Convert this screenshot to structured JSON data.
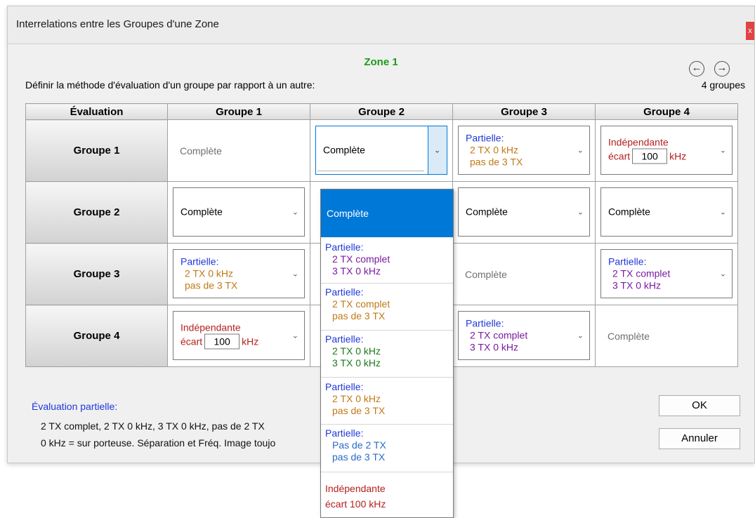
{
  "window": {
    "title": "Interrelations entre les Groupes d'une Zone",
    "close_label": "x"
  },
  "zone_title": "Zone 1",
  "nav": {
    "prev_icon": "arrow-left-circle-icon",
    "next_icon": "arrow-right-circle-icon",
    "prev_glyph": "←",
    "next_glyph": "→"
  },
  "instruction": "Définir la méthode d'évaluation d'un groupe par rapport à un autre:",
  "group_count": "4 groupes",
  "table": {
    "header": [
      "Évaluation",
      "Groupe 1",
      "Groupe 2",
      "Groupe 3",
      "Groupe 4"
    ],
    "rows": [
      {
        "label": "Groupe 1",
        "c1": "Complète",
        "c2": "Complète",
        "c3": {
          "l1": "Partielle:",
          "l2": "2 TX 0 kHz",
          "l3": "pas de 3 TX"
        },
        "c4": {
          "l1": "Indépendante",
          "l2a": "écart",
          "val": "100",
          "l2b": "kHz"
        }
      },
      {
        "label": "Groupe 2",
        "c1": "Complète",
        "c3": "Complète",
        "c4": "Complète"
      },
      {
        "label": "Groupe 3",
        "c1": {
          "l1": "Partielle:",
          "l2": "2 TX 0 kHz",
          "l3": "pas de 3 TX"
        },
        "c3": "Complète",
        "c4": {
          "l1": "Partielle:",
          "l2": "2 TX complet",
          "l3": "3 TX 0 kHz"
        }
      },
      {
        "label": "Groupe 4",
        "c1": {
          "l1": "Indépendante",
          "l2a": "écart",
          "val": "100",
          "l2b": "kHz"
        },
        "c3": {
          "l1": "Partielle:",
          "l2": "2 TX complet",
          "l3": "3 TX 0 kHz"
        },
        "c4": "Complète"
      }
    ]
  },
  "dropdown": {
    "items": [
      {
        "l1": "Complète"
      },
      {
        "l1": "Partielle:",
        "l2": "2 TX complet",
        "l3": "3 TX 0 kHz"
      },
      {
        "l1": "Partielle:",
        "l2": "2 TX complet",
        "l3": "pas de 3 TX"
      },
      {
        "l1": "Partielle:",
        "l2": "2 TX 0 kHz",
        "l3": "3 TX 0 kHz"
      },
      {
        "l1": "Partielle:",
        "l2": "2 TX 0 kHz",
        "l3": "pas de 3 TX"
      },
      {
        "l1": "Partielle:",
        "l2": "Pas de 2 TX",
        "l3": "pas de 3 TX"
      },
      {
        "l1": "Indépendante",
        "l2": "écart 100 kHz"
      }
    ]
  },
  "legend": {
    "title": "Évaluation partielle:",
    "line1": "2 TX complet, 2 TX 0 kHz, 3 TX 0 kHz, pas de 2 TX",
    "line2": "0 kHz = sur porteuse. Séparation et Fréq. Image toujo"
  },
  "buttons": {
    "ok": "OK",
    "cancel": "Annuler"
  },
  "colors": {
    "zone_green": "#1a9b1a",
    "partial_blue": "#1f38d8",
    "orange": "#c07a14",
    "purple": "#7a1aa0",
    "green": "#1a7a1a",
    "red": "#b52020",
    "selection": "#0078d7"
  }
}
